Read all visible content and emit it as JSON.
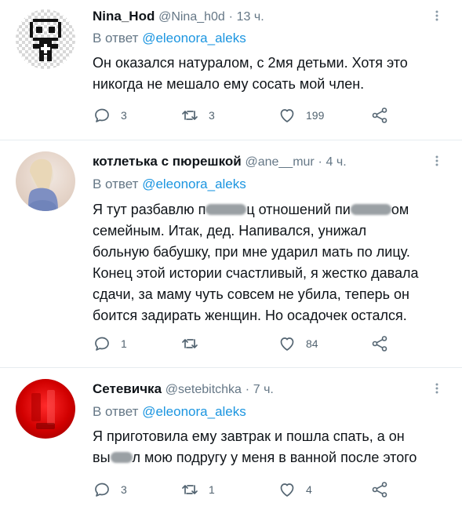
{
  "tweets": [
    {
      "author_name": "Nina_Hod",
      "handle": "@Nina_h0d",
      "time": "13 ч.",
      "reply_prefix": "В ответ",
      "reply_to": "@eleonora_aleks",
      "lines": [
        "Он оказался натуралом, с 2мя детьми. Хотя это",
        "никогда не мешало ему сосать мой член."
      ],
      "replies": "3",
      "retweets": "3",
      "likes": "199"
    },
    {
      "author_name": "котлетька с пюрешкой",
      "handle": "@ane__mur",
      "time": "4 ч.",
      "reply_prefix": "В ответ",
      "reply_to": "@eleonora_aleks",
      "line1_a": "Я тут разбавлю п",
      "line1_b": "ц отношений пи",
      "line1_c": "ом",
      "lines": [
        "семейным. Итак, дед. Напивался, унижал",
        "больную бабушку, при мне ударил мать по лицу.",
        "Конец этой истории счастливый, я жестко давала",
        "сдачи, за маму чуть совсем не убила, теперь он",
        "боится задирать женщин. Но осадочек остался."
      ],
      "replies": "1",
      "retweets": "",
      "likes": "84"
    },
    {
      "author_name": "Сетевичка",
      "handle": "@setebitchka",
      "time": "7 ч.",
      "reply_prefix": "В ответ",
      "reply_to": "@eleonora_aleks",
      "line1": "Я приготовила ему завтрак и пошла спать, а он",
      "line2_a": "вы",
      "line2_b": "л мою подругу у меня в ванной после этого",
      "replies": "3",
      "retweets": "1",
      "likes": "4"
    }
  ],
  "separator": "·",
  "colors": {
    "accent": "#1b95e0",
    "muted": "#657786",
    "text": "#0f1419"
  },
  "icons": [
    "pixel-avatar-icon",
    "more-icon",
    "reply-icon",
    "retweet-icon",
    "like-icon",
    "share-icon"
  ]
}
